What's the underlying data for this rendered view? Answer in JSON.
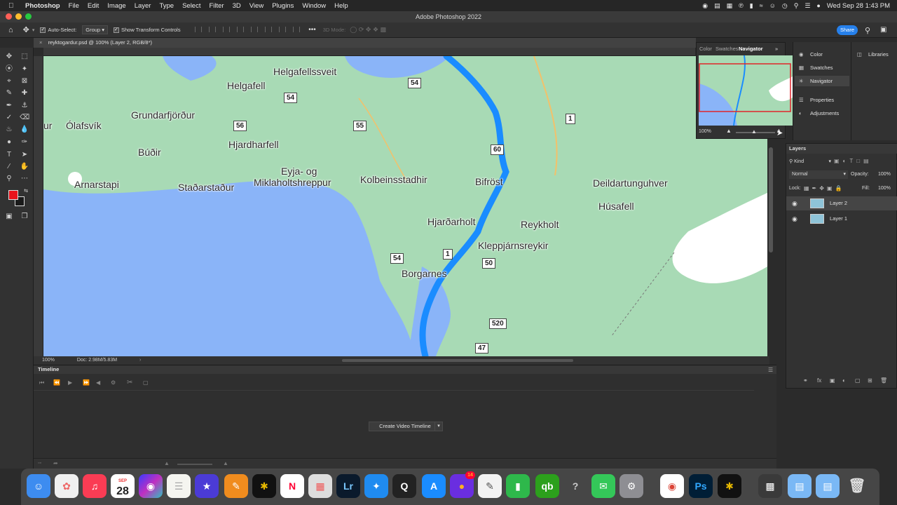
{
  "menubar": {
    "app_name": "Photoshop",
    "items": [
      "File",
      "Edit",
      "Image",
      "Layer",
      "Type",
      "Select",
      "Filter",
      "3D",
      "View",
      "Plugins",
      "Window",
      "Help"
    ],
    "datetime": "Wed Sep 28  1:43 PM"
  },
  "window": {
    "title": "Adobe Photoshop 2022"
  },
  "options_bar": {
    "auto_select_label": "Auto-Select:",
    "auto_select_value": "Group",
    "transform_controls_label": "Show Transform Controls",
    "mode_3d_label": "3D Mode:",
    "share_label": "Share"
  },
  "document": {
    "tab_title": "reyktogardur.psd @ 100% (Layer 2, RGB/8*)",
    "zoom": "100%",
    "doc_info": "Doc: 2.98M/5.83M"
  },
  "map": {
    "places": [
      "Helgafellssveit",
      "Helgafell",
      "Grundarfjörður",
      "Ólafsvík",
      "ur",
      "Hjardharfell",
      "Búðir",
      "Eyja- og",
      "Miklaholtshreppur",
      "Kolbeinsstadhir",
      "Arnarstapi",
      "Staðarstaður",
      "Bifröst",
      "Deildartunguhver",
      "Húsafell",
      "Hjarðarholt",
      "Reykholt",
      "Kleppjárnsreykir",
      "Borgarnes"
    ],
    "shields": [
      "54",
      "54",
      "56",
      "55",
      "60",
      "1",
      "54",
      "1",
      "50",
      "520",
      "47"
    ]
  },
  "timeline": {
    "title": "Timeline",
    "create_button": "Create Video Timeline"
  },
  "navigator_panel": {
    "tabs": [
      "Color",
      "Swatches",
      "Navigator"
    ],
    "active_tab": "Navigator",
    "zoom": "100%"
  },
  "side_panels": {
    "items": [
      "Color",
      "Swatches",
      "Navigator",
      "Properties",
      "Adjustments"
    ],
    "libraries": "Libraries"
  },
  "layers_panel": {
    "title": "Layers",
    "filter_kind": "Kind",
    "blend_mode": "Normal",
    "opacity_label": "Opacity:",
    "opacity_value": "100%",
    "lock_label": "Lock:",
    "fill_label": "Fill:",
    "fill_value": "100%",
    "layers": [
      "Layer 2",
      "Layer 1"
    ]
  },
  "dock": {
    "calendar_month": "SEP",
    "calendar_day": "28",
    "messages_badge": "14",
    "lr_label": "Lr",
    "ps_label": "Ps"
  },
  "colors": {
    "foreground": "#e8141c",
    "background": "#1a1a1a",
    "accent": "#2680eb",
    "route": "#1a8cff",
    "water": "#8ab4f8",
    "land": "#a8dab5"
  }
}
